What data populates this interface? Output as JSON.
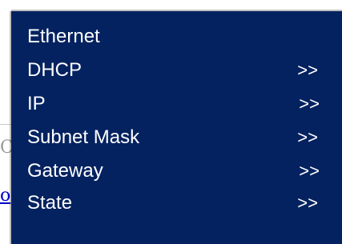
{
  "background": {
    "partial_text": "C",
    "partial_link": "o"
  },
  "menu": {
    "title": "Ethernet",
    "items": [
      {
        "label": "DHCP",
        "arrow": ">>"
      },
      {
        "label": "IP",
        "arrow": ">>"
      },
      {
        "label": "Subnet Mask",
        "arrow": ">>"
      },
      {
        "label": "Gateway",
        "arrow": ">>"
      },
      {
        "label": "State",
        "arrow": ">>"
      }
    ],
    "colors": {
      "panel_bg": "#042260",
      "text": "#ffffff"
    }
  }
}
